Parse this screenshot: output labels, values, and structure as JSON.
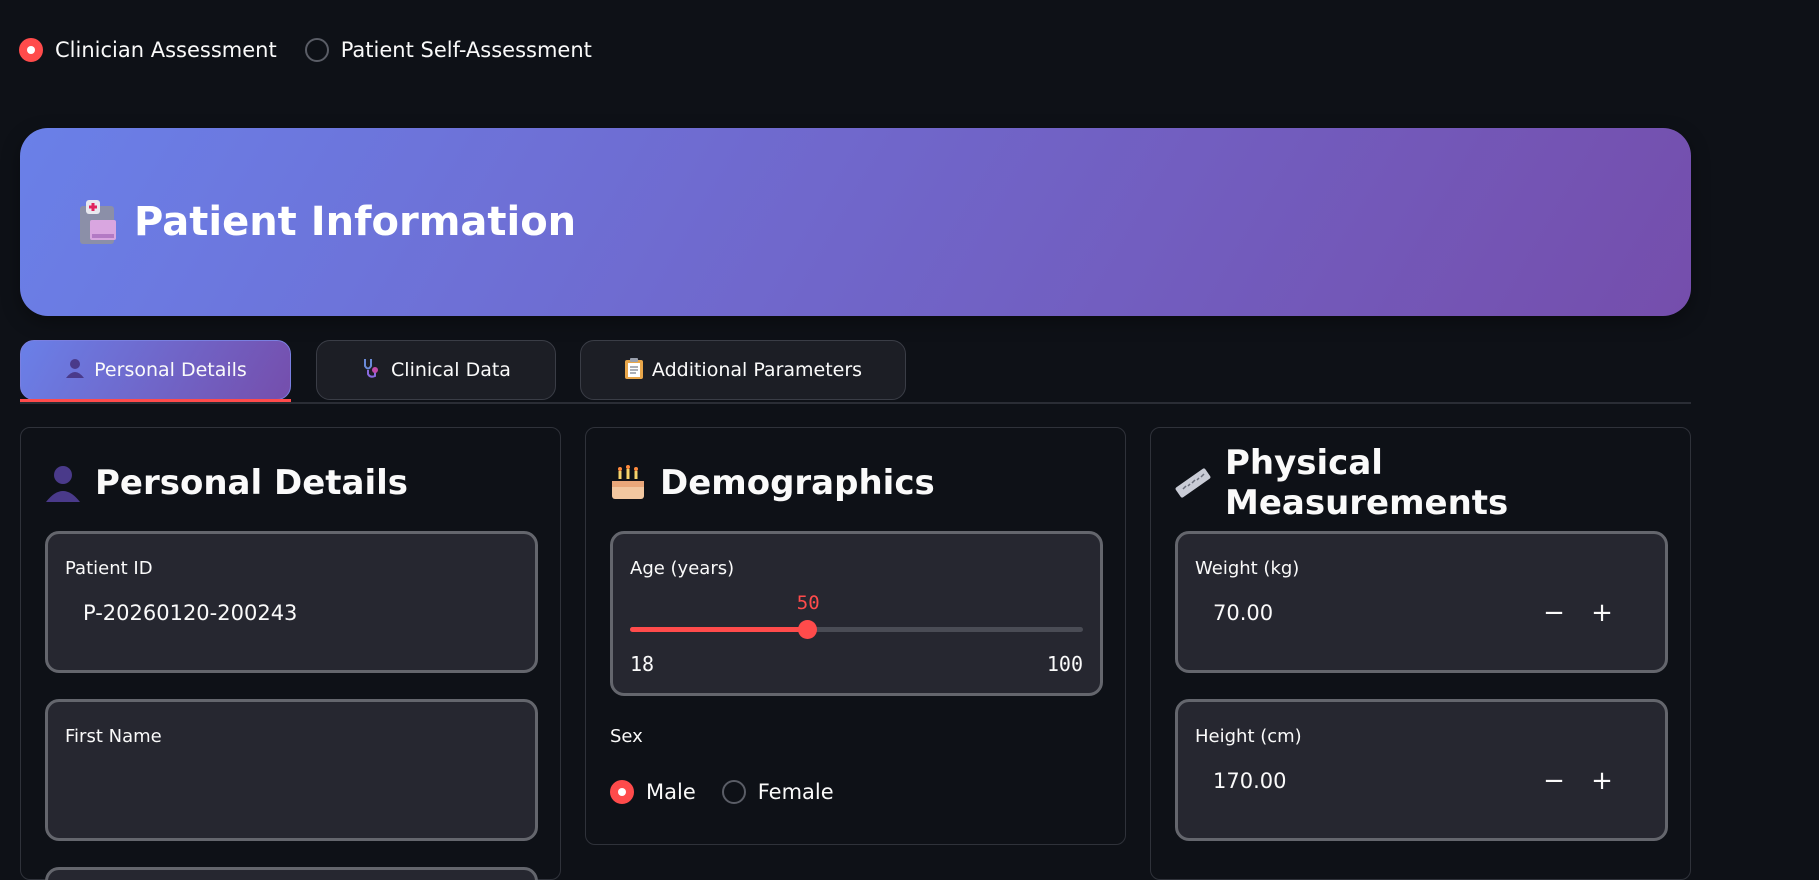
{
  "top_right_text": "",
  "mode": {
    "options": [
      {
        "label": "Clinician Assessment",
        "selected": true
      },
      {
        "label": "Patient Self-Assessment",
        "selected": false
      }
    ]
  },
  "banner": {
    "title": "Patient Information",
    "icon": "hospital-icon"
  },
  "tabs": [
    {
      "label": "Personal Details",
      "icon": "person-icon",
      "active": true
    },
    {
      "label": "Clinical Data",
      "icon": "stethoscope-icon",
      "active": false
    },
    {
      "label": "Additional Parameters",
      "icon": "clipboard-icon",
      "active": false
    }
  ],
  "personal": {
    "title": "Personal Details",
    "icon": "person-icon",
    "patient_id_label": "Patient ID",
    "patient_id_value": "P-20260120-200243",
    "first_name_label": "First Name",
    "first_name_value": ""
  },
  "demographics": {
    "title": "Demographics",
    "icon": "cake-icon",
    "age_label": "Age (years)",
    "age_value": "50",
    "age_min": "18",
    "age_max": "100",
    "sex_label": "Sex",
    "sex_options": [
      {
        "label": "Male",
        "selected": true
      },
      {
        "label": "Female",
        "selected": false
      }
    ]
  },
  "physical": {
    "title": "Physical Measurements",
    "icon": "ruler-icon",
    "weight_label": "Weight (kg)",
    "weight_value": "70.00",
    "height_label": "Height (cm)",
    "height_value": "170.00",
    "minus": "−",
    "plus": "+"
  },
  "colors": {
    "accent": "#ff4b4b",
    "background": "#0e1117",
    "card": "#262730"
  }
}
